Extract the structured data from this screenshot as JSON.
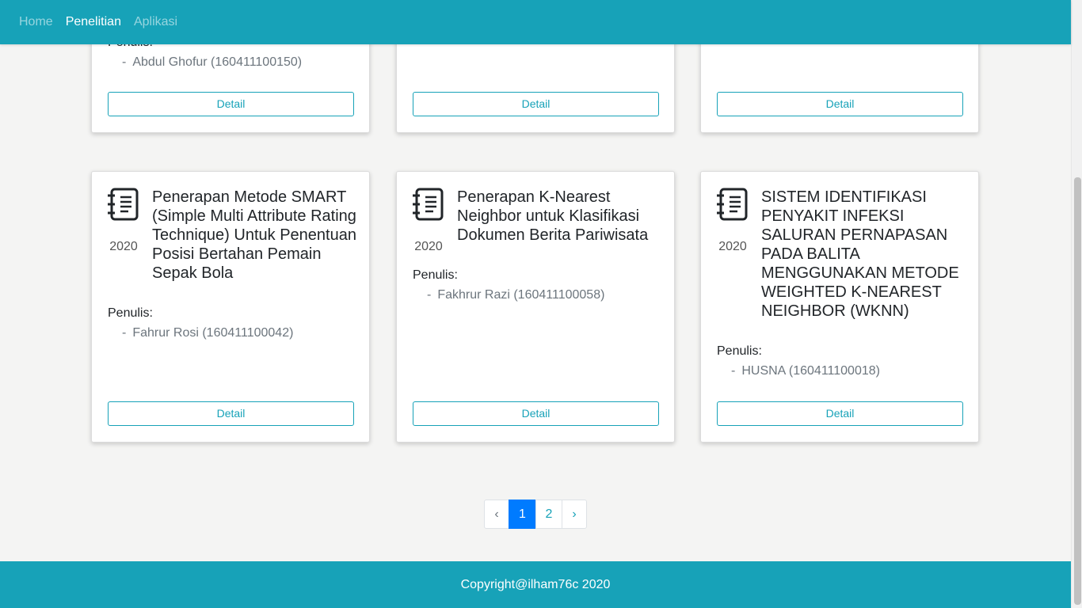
{
  "nav": {
    "items": [
      {
        "label": "Home"
      },
      {
        "label": "Penelitian"
      },
      {
        "label": "Aplikasi"
      }
    ]
  },
  "top_row": {
    "cards": [
      {
        "penulis_label": "Penulis:",
        "author": "Abdul Ghofur (160411100150)",
        "detail_label": "Detail"
      },
      {
        "detail_label": "Detail"
      },
      {
        "detail_label": "Detail"
      }
    ]
  },
  "cards": [
    {
      "year": "2020",
      "title": "Penerapan Metode SMART (Simple Multi Attribute Rating Technique) Untuk Penentuan Posisi Bertahan Pemain Sepak Bola",
      "penulis_label": "Penulis:",
      "author": "Fahrur Rosi (160411100042)",
      "detail_label": "Detail"
    },
    {
      "year": "2020",
      "title": "Penerapan K-Nearest Neighbor untuk Klasifikasi Dokumen Berita Pariwisata",
      "penulis_label": "Penulis:",
      "author": "Fakhrur Razi (160411100058)",
      "detail_label": "Detail"
    },
    {
      "year": "2020",
      "title": "SISTEM IDENTIFIKASI PENYAKIT INFEKSI SALURAN PERNAPASAN PADA BALITA MENGGUNAKAN METODE WEIGHTED K-NEAREST NEIGHBOR (WKNN)",
      "penulis_label": "Penulis:",
      "author": "HUSNA (160411100018)",
      "detail_label": "Detail"
    }
  ],
  "pagination": {
    "prev": "‹",
    "pages": [
      "1",
      "2"
    ],
    "next": "›",
    "current": "1"
  },
  "footer": {
    "text": "Copyright@ilham76c 2020"
  },
  "colors": {
    "primary": "#17a2b8",
    "page_active": "#007bff",
    "background": "#f4f4f3"
  },
  "icons": {
    "card_icon": "notebook-icon"
  }
}
